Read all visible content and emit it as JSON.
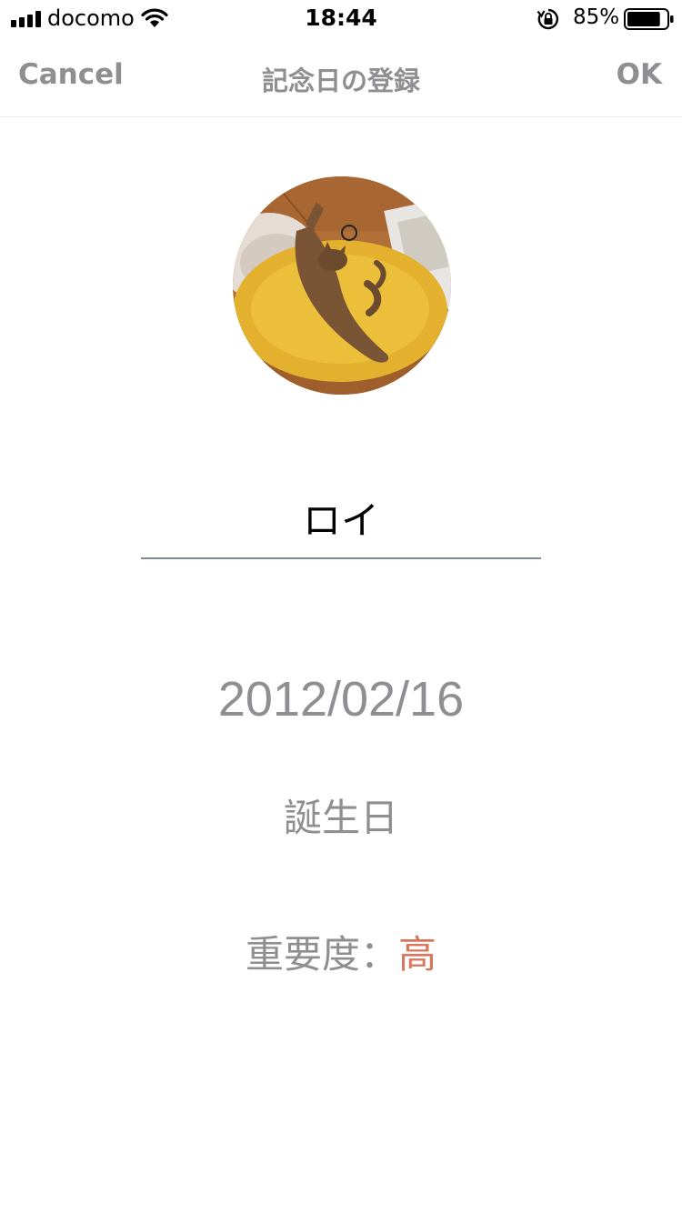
{
  "status_bar": {
    "carrier": "docomo",
    "time": "18:44",
    "battery_percent": "85%",
    "battery_level": 0.85,
    "signal_icon": "signal-bars-icon",
    "wifi_icon": "wifi-icon",
    "rotation_lock_icon": "rotation-lock-icon"
  },
  "nav": {
    "cancel_label": "Cancel",
    "title": "記念日の登録",
    "ok_label": "OK"
  },
  "form": {
    "name_value": "ロイ",
    "date_value": "2012/02/16",
    "category_value": "誕生日",
    "importance_label": "重要度：",
    "importance_value": "高"
  },
  "colors": {
    "nav_text": "#8e8e93",
    "underline": "#7d8a94",
    "importance_accent": "#d9765e"
  }
}
